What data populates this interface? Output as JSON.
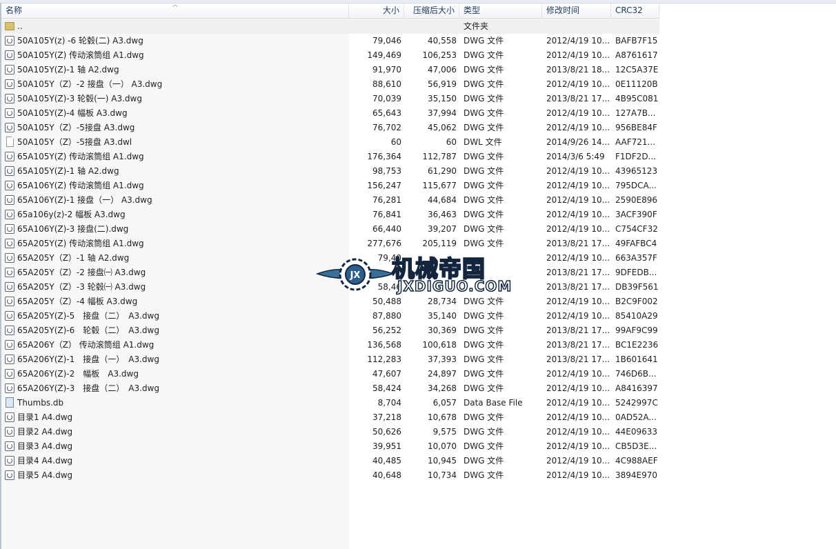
{
  "columns": {
    "name": "名称",
    "size": "大小",
    "packed": "压缩后大小",
    "type": "类型",
    "modified": "修改时间",
    "crc": "CRC32"
  },
  "parent_row": {
    "name": "..",
    "type": "文件夹"
  },
  "files": [
    {
      "icon": "dwg-file-icon",
      "name": "50A105Y(z) -6 轮毂(二) A3.dwg",
      "size": "79,046",
      "packed": "40,558",
      "type": "DWG 文件",
      "modified": "2012/4/19 10...",
      "crc": "BAFB7F15"
    },
    {
      "icon": "dwg-file-icon",
      "name": "50A105Y(Z) 传动滚筒组 A1.dwg",
      "size": "149,469",
      "packed": "106,253",
      "type": "DWG 文件",
      "modified": "2012/4/19 10...",
      "crc": "A8761617"
    },
    {
      "icon": "dwg-file-icon",
      "name": "50A105Y(Z)-1 轴 A2.dwg",
      "size": "91,970",
      "packed": "47,006",
      "type": "DWG 文件",
      "modified": "2013/8/21 18...",
      "crc": "12C5A37E"
    },
    {
      "icon": "dwg-file-icon",
      "name": "50A105Y（Z）-2 接盘（一） A3.dwg",
      "size": "88,610",
      "packed": "56,919",
      "type": "DWG 文件",
      "modified": "2012/4/19 10...",
      "crc": "0E11120B"
    },
    {
      "icon": "dwg-file-icon",
      "name": "50A105Y(Z)-3 轮毂(一) A3.dwg",
      "size": "70,039",
      "packed": "35,150",
      "type": "DWG 文件",
      "modified": "2013/8/21 17...",
      "crc": "4B95C081"
    },
    {
      "icon": "dwg-file-icon",
      "name": "50A105Y(Z)-4 幅板 A3.dwg",
      "size": "65,643",
      "packed": "37,994",
      "type": "DWG 文件",
      "modified": "2012/4/19 10...",
      "crc": "127A7B..."
    },
    {
      "icon": "dwg-file-icon",
      "name": "50A105Y（Z）-5接盘 A3.dwg",
      "size": "76,702",
      "packed": "45,062",
      "type": "DWG 文件",
      "modified": "2012/4/19 10...",
      "crc": "956BE84F"
    },
    {
      "icon": "dwl-file-icon",
      "name": "50A105Y（Z）-5接盘 A3.dwl",
      "size": "60",
      "packed": "60",
      "type": "DWL 文件",
      "modified": "2014/9/26 14...",
      "crc": "AAF721..."
    },
    {
      "icon": "dwg-file-icon",
      "name": "65A105Y(Z) 传动滚筒组 A1.dwg",
      "size": "176,364",
      "packed": "112,787",
      "type": "DWG 文件",
      "modified": "2014/3/6 5:49",
      "crc": "F1DF2D..."
    },
    {
      "icon": "dwg-file-icon",
      "name": "65A105Y(Z)-1 轴 A2.dwg",
      "size": "98,753",
      "packed": "61,290",
      "type": "DWG 文件",
      "modified": "2012/4/19 10...",
      "crc": "43965123"
    },
    {
      "icon": "dwg-file-icon",
      "name": "65A106Y(Z) 传动滚筒组 A1.dwg",
      "size": "156,247",
      "packed": "115,677",
      "type": "DWG 文件",
      "modified": "2012/4/19 10...",
      "crc": "795DCA..."
    },
    {
      "icon": "dwg-file-icon",
      "name": "65A106Y(Z)-1 接盘（一） A3.dwg",
      "size": "76,281",
      "packed": "44,684",
      "type": "DWG 文件",
      "modified": "2012/4/19 10...",
      "crc": "2590E896"
    },
    {
      "icon": "dwg-file-icon",
      "name": "65a106y(z)-2 幅板 A3.dwg",
      "size": "76,841",
      "packed": "36,463",
      "type": "DWG 文件",
      "modified": "2012/4/19 10...",
      "crc": "3ACF390F"
    },
    {
      "icon": "dwg-file-icon",
      "name": "65A106Y(Z)-3 接盘(二).dwg",
      "size": "66,440",
      "packed": "39,207",
      "type": "DWG 文件",
      "modified": "2012/4/19 10...",
      "crc": "C754CF32"
    },
    {
      "icon": "dwg-file-icon",
      "name": "65A205Y(Z) 传动滚筒组 A1.dwg",
      "size": "277,676",
      "packed": "205,119",
      "type": "DWG 文件",
      "modified": "2013/8/21 17...",
      "crc": "49FAFBC4"
    },
    {
      "icon": "dwg-file-icon",
      "name": "65A205Y（Z）-1 轴 A2.dwg",
      "size": "79,40",
      "packed": "",
      "type": "",
      "modified": "2012/4/19 10...",
      "crc": "663A357F"
    },
    {
      "icon": "dwg-file-icon",
      "name": "65A205Y（Z）-2 接盘㈠ A3.dwg",
      "size": "",
      "packed": "",
      "type": "",
      "modified": "2013/8/21 17...",
      "crc": "9DFEDB..."
    },
    {
      "icon": "dwg-file-icon",
      "name": "65A205Y（Z）-3 轮毂㈠ A3.dwg",
      "size": "58,46",
      "packed": "",
      "type": "",
      "modified": "2013/8/21 17...",
      "crc": "DB39F561"
    },
    {
      "icon": "dwg-file-icon",
      "name": "65A205Y（Z）-4 幅板 A3.dwg",
      "size": "50,488",
      "packed": "28,734",
      "type": "DWG 文件",
      "modified": "2012/4/19 10...",
      "crc": "B2C9F002"
    },
    {
      "icon": "dwg-file-icon",
      "name": "65A205Y(Z)-5　接盘（二）　A3.dwg",
      "size": "87,880",
      "packed": "35,140",
      "type": "DWG 文件",
      "modified": "2012/4/19 10...",
      "crc": "85410A29"
    },
    {
      "icon": "dwg-file-icon",
      "name": "65A205Y(Z)-6　轮毂（二）　A3.dwg",
      "size": "56,252",
      "packed": "30,369",
      "type": "DWG 文件",
      "modified": "2013/8/21 17...",
      "crc": "99AF9C99"
    },
    {
      "icon": "dwg-file-icon",
      "name": "65A206Y（Z） 传动滚筒组 A1.dwg",
      "size": "136,568",
      "packed": "100,618",
      "type": "DWG 文件",
      "modified": "2013/8/21 17...",
      "crc": "BC1E2236"
    },
    {
      "icon": "dwg-file-icon",
      "name": "65A206Y(Z)-1　接盘（一）　A3.dwg",
      "size": "112,283",
      "packed": "37,393",
      "type": "DWG 文件",
      "modified": "2013/8/21 17...",
      "crc": "1B601641"
    },
    {
      "icon": "dwg-file-icon",
      "name": "65A206Y(Z)-2　幅板　A3.dwg",
      "size": "47,607",
      "packed": "24,897",
      "type": "DWG 文件",
      "modified": "2012/4/19 10...",
      "crc": "746D6B..."
    },
    {
      "icon": "dwg-file-icon",
      "name": "65A206Y(Z)-3　接盘（二）　A3.dwg",
      "size": "58,424",
      "packed": "34,268",
      "type": "DWG 文件",
      "modified": "2012/4/19 10...",
      "crc": "A8416397"
    },
    {
      "icon": "db-file-icon",
      "name": "Thumbs.db",
      "size": "8,704",
      "packed": "6,057",
      "type": "Data Base File",
      "modified": "2012/4/19 10...",
      "crc": "5242997C"
    },
    {
      "icon": "dwg-file-icon",
      "name": "目录1 A4.dwg",
      "size": "37,218",
      "packed": "10,678",
      "type": "DWG 文件",
      "modified": "2012/4/19 10...",
      "crc": "0AD52A..."
    },
    {
      "icon": "dwg-file-icon",
      "name": "目录2 A4.dwg",
      "size": "50,626",
      "packed": "9,575",
      "type": "DWG 文件",
      "modified": "2012/4/19 10...",
      "crc": "44E09633"
    },
    {
      "icon": "dwg-file-icon",
      "name": "目录3 A4.dwg",
      "size": "39,951",
      "packed": "10,070",
      "type": "DWG 文件",
      "modified": "2012/4/19 10...",
      "crc": "CB5D3E..."
    },
    {
      "icon": "dwg-file-icon",
      "name": "目录4 A4.dwg",
      "size": "40,485",
      "packed": "10,945",
      "type": "DWG 文件",
      "modified": "2012/4/19 10...",
      "crc": "4C988AEF"
    },
    {
      "icon": "dwg-file-icon",
      "name": "目录5 A4.dwg",
      "size": "40,648",
      "packed": "10,734",
      "type": "DWG 文件",
      "modified": "2012/4/19 10...",
      "crc": "3894E970"
    }
  ],
  "watermark": {
    "title": "机械帝国",
    "url": "JXDIGUO.COM",
    "badge": "JX"
  }
}
